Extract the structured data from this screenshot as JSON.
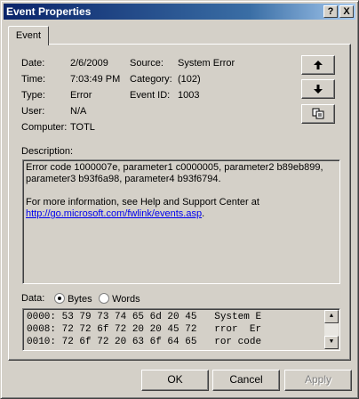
{
  "window": {
    "title": "Event Properties",
    "help_label": "?",
    "close_label": "X"
  },
  "tabs": [
    {
      "label": "Event"
    }
  ],
  "event": {
    "date_label": "Date:",
    "date": "2/6/2009",
    "time_label": "Time:",
    "time": "7:03:49 PM",
    "type_label": "Type:",
    "type": "Error",
    "user_label": "User:",
    "user": "N/A",
    "computer_label": "Computer:",
    "computer": "TOTL",
    "source_label": "Source:",
    "source": "System Error",
    "category_label": "Category:",
    "category": "(102)",
    "eventid_label": "Event ID:",
    "eventid": "1003"
  },
  "nav": {
    "up_icon": "arrow-up-icon",
    "down_icon": "arrow-down-icon",
    "copy_icon": "copy-icon"
  },
  "description": {
    "label": "Description:",
    "line1": "Error code 1000007e, parameter1 c0000005, parameter2 b89eb899,",
    "line2": "parameter3 b93f6a98, parameter4 b93f6794.",
    "line3": "For more information, see Help and Support Center at",
    "link": "http://go.microsoft.com/fwlink/events.asp",
    "link_suffix": "."
  },
  "data": {
    "label": "Data:",
    "bytes_label": "Bytes",
    "words_label": "Words",
    "selected": "Bytes",
    "rows": [
      "0000: 53 79 73 74 65 6d 20 45   System E",
      "0008: 72 72 6f 72 20 20 45 72   rror  Er",
      "0010: 72 6f 72 20 63 6f 64 65   ror code"
    ]
  },
  "buttons": {
    "ok": "OK",
    "cancel": "Cancel",
    "apply": "Apply"
  }
}
